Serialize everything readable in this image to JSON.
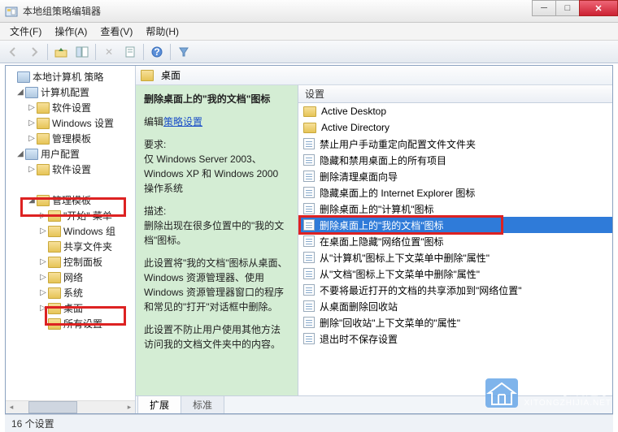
{
  "window": {
    "title": "本地组策略编辑器"
  },
  "menu": {
    "file": "文件(F)",
    "action": "操作(A)",
    "view": "查看(V)",
    "help": "帮助(H)"
  },
  "tree": {
    "root": "本地计算机 策略",
    "n1": "计算机配置",
    "n1a": "软件设置",
    "n1b": "Windows 设置",
    "n1c": "管理模板",
    "n2": "用户配置",
    "n2a": "软件设置",
    "n2c": "管理模板",
    "n2c1": "\"开始\" 菜单",
    "n2c2": "Windows 组",
    "n2c3": "共享文件夹",
    "n2c4": "控制面板",
    "n2c5": "网络",
    "n2c6": "系统",
    "n2c7": "桌面",
    "n2c8": "所有设置"
  },
  "header": {
    "icon_label": "桌面"
  },
  "desc": {
    "title": "删除桌面上的\"我的文档\"图标",
    "edit_prefix": "编辑",
    "edit_link": "策略设置",
    "req_label": "要求:",
    "req_body": "仅 Windows Server 2003、Windows XP 和 Windows 2000 操作系统",
    "desc_label": "描述:",
    "desc_body1": "删除出现在很多位置中的\"我的文档\"图标。",
    "desc_body2": "此设置将\"我的文档\"图标从桌面、Windows 资源管理器、使用 Windows 资源管理器窗口的程序和常见的\"打开\"对话框中删除。",
    "desc_body3": "此设置不防止用户使用其他方法访问我的文档文件夹中的内容。"
  },
  "listhead": "设置",
  "list": {
    "f1": "Active Desktop",
    "f2": "Active Directory",
    "p1": "禁止用户手动重定向配置文件文件夹",
    "p2": "隐藏和禁用桌面上的所有项目",
    "p3": "删除清理桌面向导",
    "p4": "隐藏桌面上的 Internet Explorer 图标",
    "p5": "删除桌面上的\"计算机\"图标",
    "p6": "删除桌面上的\"我的文档\"图标",
    "p7": "在桌面上隐藏\"网络位置\"图标",
    "p8": "从\"计算机\"图标上下文菜单中删除\"属性\"",
    "p9": "从\"文档\"图标上下文菜单中删除\"属性\"",
    "p10": "不要将最近打开的文档的共享添加到\"网络位置\"",
    "p11": "从桌面删除回收站",
    "p12": "删除\"回收站\"上下文菜单的\"属性\"",
    "p13": "退出时不保存设置"
  },
  "tabs": {
    "extended": "扩展",
    "standard": "标准"
  },
  "status": "16 个设置",
  "watermark": {
    "line1": "系统之家",
    "line2": "XITONGZHIJIA.NET"
  }
}
